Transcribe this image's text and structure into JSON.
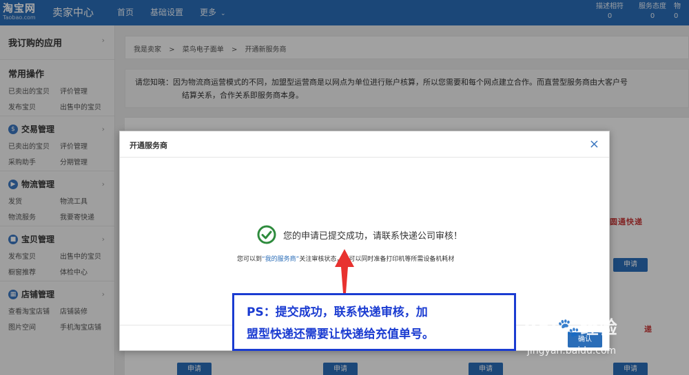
{
  "header": {
    "logo": "淘宝网",
    "logo_sub": "Taobao.com",
    "section": "卖家中心",
    "nav": [
      "首页",
      "基础设置",
      "更多"
    ],
    "stats": [
      {
        "label": "描述相符",
        "value": "0"
      },
      {
        "label": "服务态度",
        "value": "0"
      },
      {
        "label": "物",
        "value": "0"
      }
    ]
  },
  "sidebar": {
    "apps_title": "我订购的应用",
    "common": {
      "title": "常用操作",
      "links": [
        "已卖出的宝贝",
        "评价管理",
        "发布宝贝",
        "出售中的宝贝"
      ]
    },
    "sections": [
      {
        "title": "交易管理",
        "links": [
          "已卖出的宝贝",
          "评价管理",
          "采购助手",
          "分期管理"
        ]
      },
      {
        "title": "物流管理",
        "links": [
          "发货",
          "物流工具",
          "物流服务",
          "我要寄快递"
        ]
      },
      {
        "title": "宝贝管理",
        "links": [
          "发布宝贝",
          "出售中的宝贝",
          "橱窗推荐",
          "体检中心"
        ]
      },
      {
        "title": "店铺管理",
        "links": [
          "查看淘宝店铺",
          "店铺装修",
          "图片空间",
          "手机淘宝店铺"
        ]
      }
    ]
  },
  "breadcrumb": [
    "我是卖家",
    ">",
    "菜鸟电子面单",
    ">",
    "开通新服务商"
  ],
  "notice": {
    "line1": "请您知晓：因为物流商运营模式的不同，加盟型运营商是以网点为单位进行账户核算，所以您需要和每个网点建立合作。而直营型服务商由大客户号",
    "line2": "结算关系，合作关系即服务商本身。"
  },
  "background": {
    "apply_label": "申请",
    "partial_logo_1": "圆通快递",
    "partial_logo_2": "递"
  },
  "modal": {
    "title": "开通服务商",
    "close": "×",
    "success": "您的申请已提交成功，请联系快递公司审核！",
    "sub_prefix": "您可以到",
    "sub_link": "“我的服务商”",
    "sub_suffix": "关注审核状态，并可以同时准备打印机等所需设备机耗材",
    "confirm": "确认"
  },
  "annotation": {
    "line1": "PS：提交成功，联系快递审核，加",
    "line2": "盟型快递还需要让快递给充值单号。"
  },
  "watermark": {
    "main": "Bai🐾经验",
    "sub": "jingyan.baidu.com"
  },
  "colors": {
    "brand": "#2a6db8",
    "success": "#2e8b3d",
    "annotation": "#1a3bd1",
    "arrow": "#e8322f"
  }
}
